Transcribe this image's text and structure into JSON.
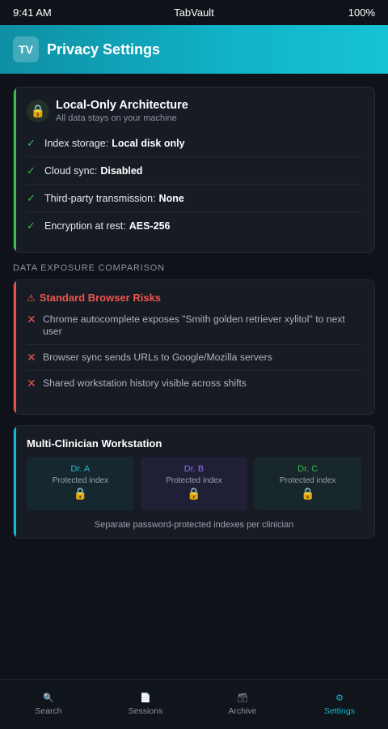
{
  "status": {
    "time": "9:41 AM",
    "app": "TabVault",
    "battery": "100%"
  },
  "header": {
    "logo": "TV",
    "title": "Privacy Settings"
  },
  "architecture": {
    "icon": "lock-icon",
    "title": "Local-Only Architecture",
    "subtitle": "All data stays on your machine",
    "items": [
      {
        "label": "Index storage:",
        "value": "Local disk only"
      },
      {
        "label": "Cloud sync:",
        "value": "Disabled"
      },
      {
        "label": "Third-party transmission:",
        "value": "None"
      },
      {
        "label": "Encryption at rest:",
        "value": "AES-256"
      }
    ]
  },
  "section_label": "DATA EXPOSURE COMPARISON",
  "risks": {
    "title": "Standard Browser Risks",
    "items": [
      "Chrome autocomplete exposes \"Smith golden retriever xylitol\" to next user",
      "Browser sync sends URLs to Google/Mozilla servers",
      "Shared workstation history visible across shifts"
    ]
  },
  "multi": {
    "title": "Multi-Clinician Workstation",
    "clinicians": [
      {
        "name": "Dr. A",
        "sub": "Protected index",
        "color": "#22b8cf"
      },
      {
        "name": "Dr. B",
        "sub": "Protected index",
        "color": "#8b6cf5"
      },
      {
        "name": "Dr. C",
        "sub": "Protected index",
        "color": "#3fb950"
      }
    ],
    "footer": "Separate password-protected indexes per clinician"
  },
  "tabs": [
    {
      "label": "Search",
      "icon": "search-icon"
    },
    {
      "label": "Sessions",
      "icon": "document-icon"
    },
    {
      "label": "Archive",
      "icon": "archive-icon"
    },
    {
      "label": "Settings",
      "icon": "gear-icon",
      "active": true
    }
  ],
  "colors": {
    "accent": "#14b8d4",
    "ok": "#3fb950",
    "danger": "#e5534b"
  }
}
